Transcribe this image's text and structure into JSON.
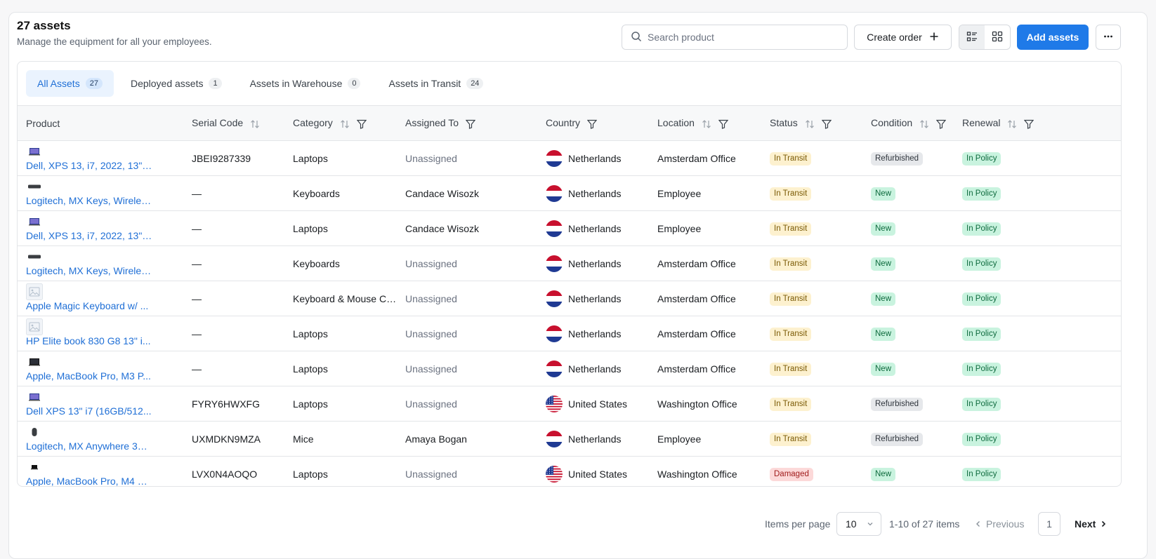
{
  "header": {
    "title": "27 assets",
    "subtitle": "Manage the equipment for all your employees."
  },
  "toolbar": {
    "search_placeholder": "Search product",
    "create_order_label": "Create order",
    "add_assets_label": "Add assets",
    "active_view": "list"
  },
  "tabs": [
    {
      "label": "All Assets",
      "count": "27",
      "active": true
    },
    {
      "label": "Deployed assets",
      "count": "1",
      "active": false
    },
    {
      "label": "Assets in Warehouse",
      "count": "0",
      "active": false
    },
    {
      "label": "Assets in Transit",
      "count": "24",
      "active": false
    }
  ],
  "columns": {
    "product": "Product",
    "serial": "Serial Code",
    "category": "Category",
    "assigned": "Assigned To",
    "country": "Country",
    "location": "Location",
    "status": "Status",
    "condition": "Condition",
    "renewal": "Renewal"
  },
  "rows": [
    {
      "product": "Dell, XPS 13, i7, 2022, 13\", ...",
      "thumb": "laptop-dell",
      "serial": "JBEI9287339",
      "category": "Laptops",
      "assigned": "Unassigned",
      "country": "Netherlands",
      "flag": "nl",
      "location": "Amsterdam Office",
      "status": "In Transit",
      "condition": "Refurbished",
      "renewal": "In Policy"
    },
    {
      "product": "Logitech, MX Keys, Wireles...",
      "thumb": "keyboard",
      "serial": "—",
      "category": "Keyboards",
      "assigned": "Candace Wisozk",
      "country": "Netherlands",
      "flag": "nl",
      "location": "Employee",
      "status": "In Transit",
      "condition": "New",
      "renewal": "In Policy"
    },
    {
      "product": "Dell, XPS 13, i7, 2022, 13\", ...",
      "thumb": "laptop-dell",
      "serial": "—",
      "category": "Laptops",
      "assigned": "Candace Wisozk",
      "country": "Netherlands",
      "flag": "nl",
      "location": "Employee",
      "status": "In Transit",
      "condition": "New",
      "renewal": "In Policy"
    },
    {
      "product": "Logitech, MX Keys, Wireles...",
      "thumb": "keyboard",
      "serial": "—",
      "category": "Keyboards",
      "assigned": "Unassigned",
      "country": "Netherlands",
      "flag": "nl",
      "location": "Amsterdam Office",
      "status": "In Transit",
      "condition": "New",
      "renewal": "In Policy"
    },
    {
      "product": "Apple Magic Keyboard w/ ...",
      "thumb": "placeholder",
      "serial": "—",
      "category": "Keyboard & Mouse Co...",
      "assigned": "Unassigned",
      "country": "Netherlands",
      "flag": "nl",
      "location": "Amsterdam Office",
      "status": "In Transit",
      "condition": "New",
      "renewal": "In Policy"
    },
    {
      "product": "HP Elite book 830 G8 13\" i...",
      "thumb": "placeholder",
      "serial": "—",
      "category": "Laptops",
      "assigned": "Unassigned",
      "country": "Netherlands",
      "flag": "nl",
      "location": "Amsterdam Office",
      "status": "In Transit",
      "condition": "New",
      "renewal": "In Policy"
    },
    {
      "product": "Apple, MacBook Pro, M3 P...",
      "thumb": "laptop-mac",
      "serial": "—",
      "category": "Laptops",
      "assigned": "Unassigned",
      "country": "Netherlands",
      "flag": "nl",
      "location": "Amsterdam Office",
      "status": "In Transit",
      "condition": "New",
      "renewal": "In Policy"
    },
    {
      "product": "Dell XPS 13\" i7 (16GB/512...",
      "thumb": "laptop-dell",
      "serial": "FYRY6HWXFG",
      "category": "Laptops",
      "assigned": "Unassigned",
      "country": "United States",
      "flag": "us",
      "location": "Washington Office",
      "status": "In Transit",
      "condition": "Refurbished",
      "renewal": "In Policy"
    },
    {
      "product": "Logitech, MX Anywhere 3S ...",
      "thumb": "mouse",
      "serial": "UXMDKN9MZA",
      "category": "Mice",
      "assigned": "Amaya Bogan",
      "country": "Netherlands",
      "flag": "nl",
      "location": "Employee",
      "status": "In Transit",
      "condition": "Refurbished",
      "renewal": "In Policy"
    },
    {
      "product": "Apple, MacBook Pro, M4 M...",
      "thumb": "laptop-mac-small",
      "serial": "LVX0N4AOQO",
      "category": "Laptops",
      "assigned": "Unassigned",
      "country": "United States",
      "flag": "us",
      "location": "Washington Office",
      "status": "Damaged",
      "condition": "New",
      "renewal": "In Policy"
    }
  ],
  "pagination": {
    "items_per_page_label": "Items per page",
    "items_per_page_value": "10",
    "range": "1-10 of 27 items",
    "previous_label": "Previous",
    "current_page": "1",
    "next_label": "Next"
  }
}
